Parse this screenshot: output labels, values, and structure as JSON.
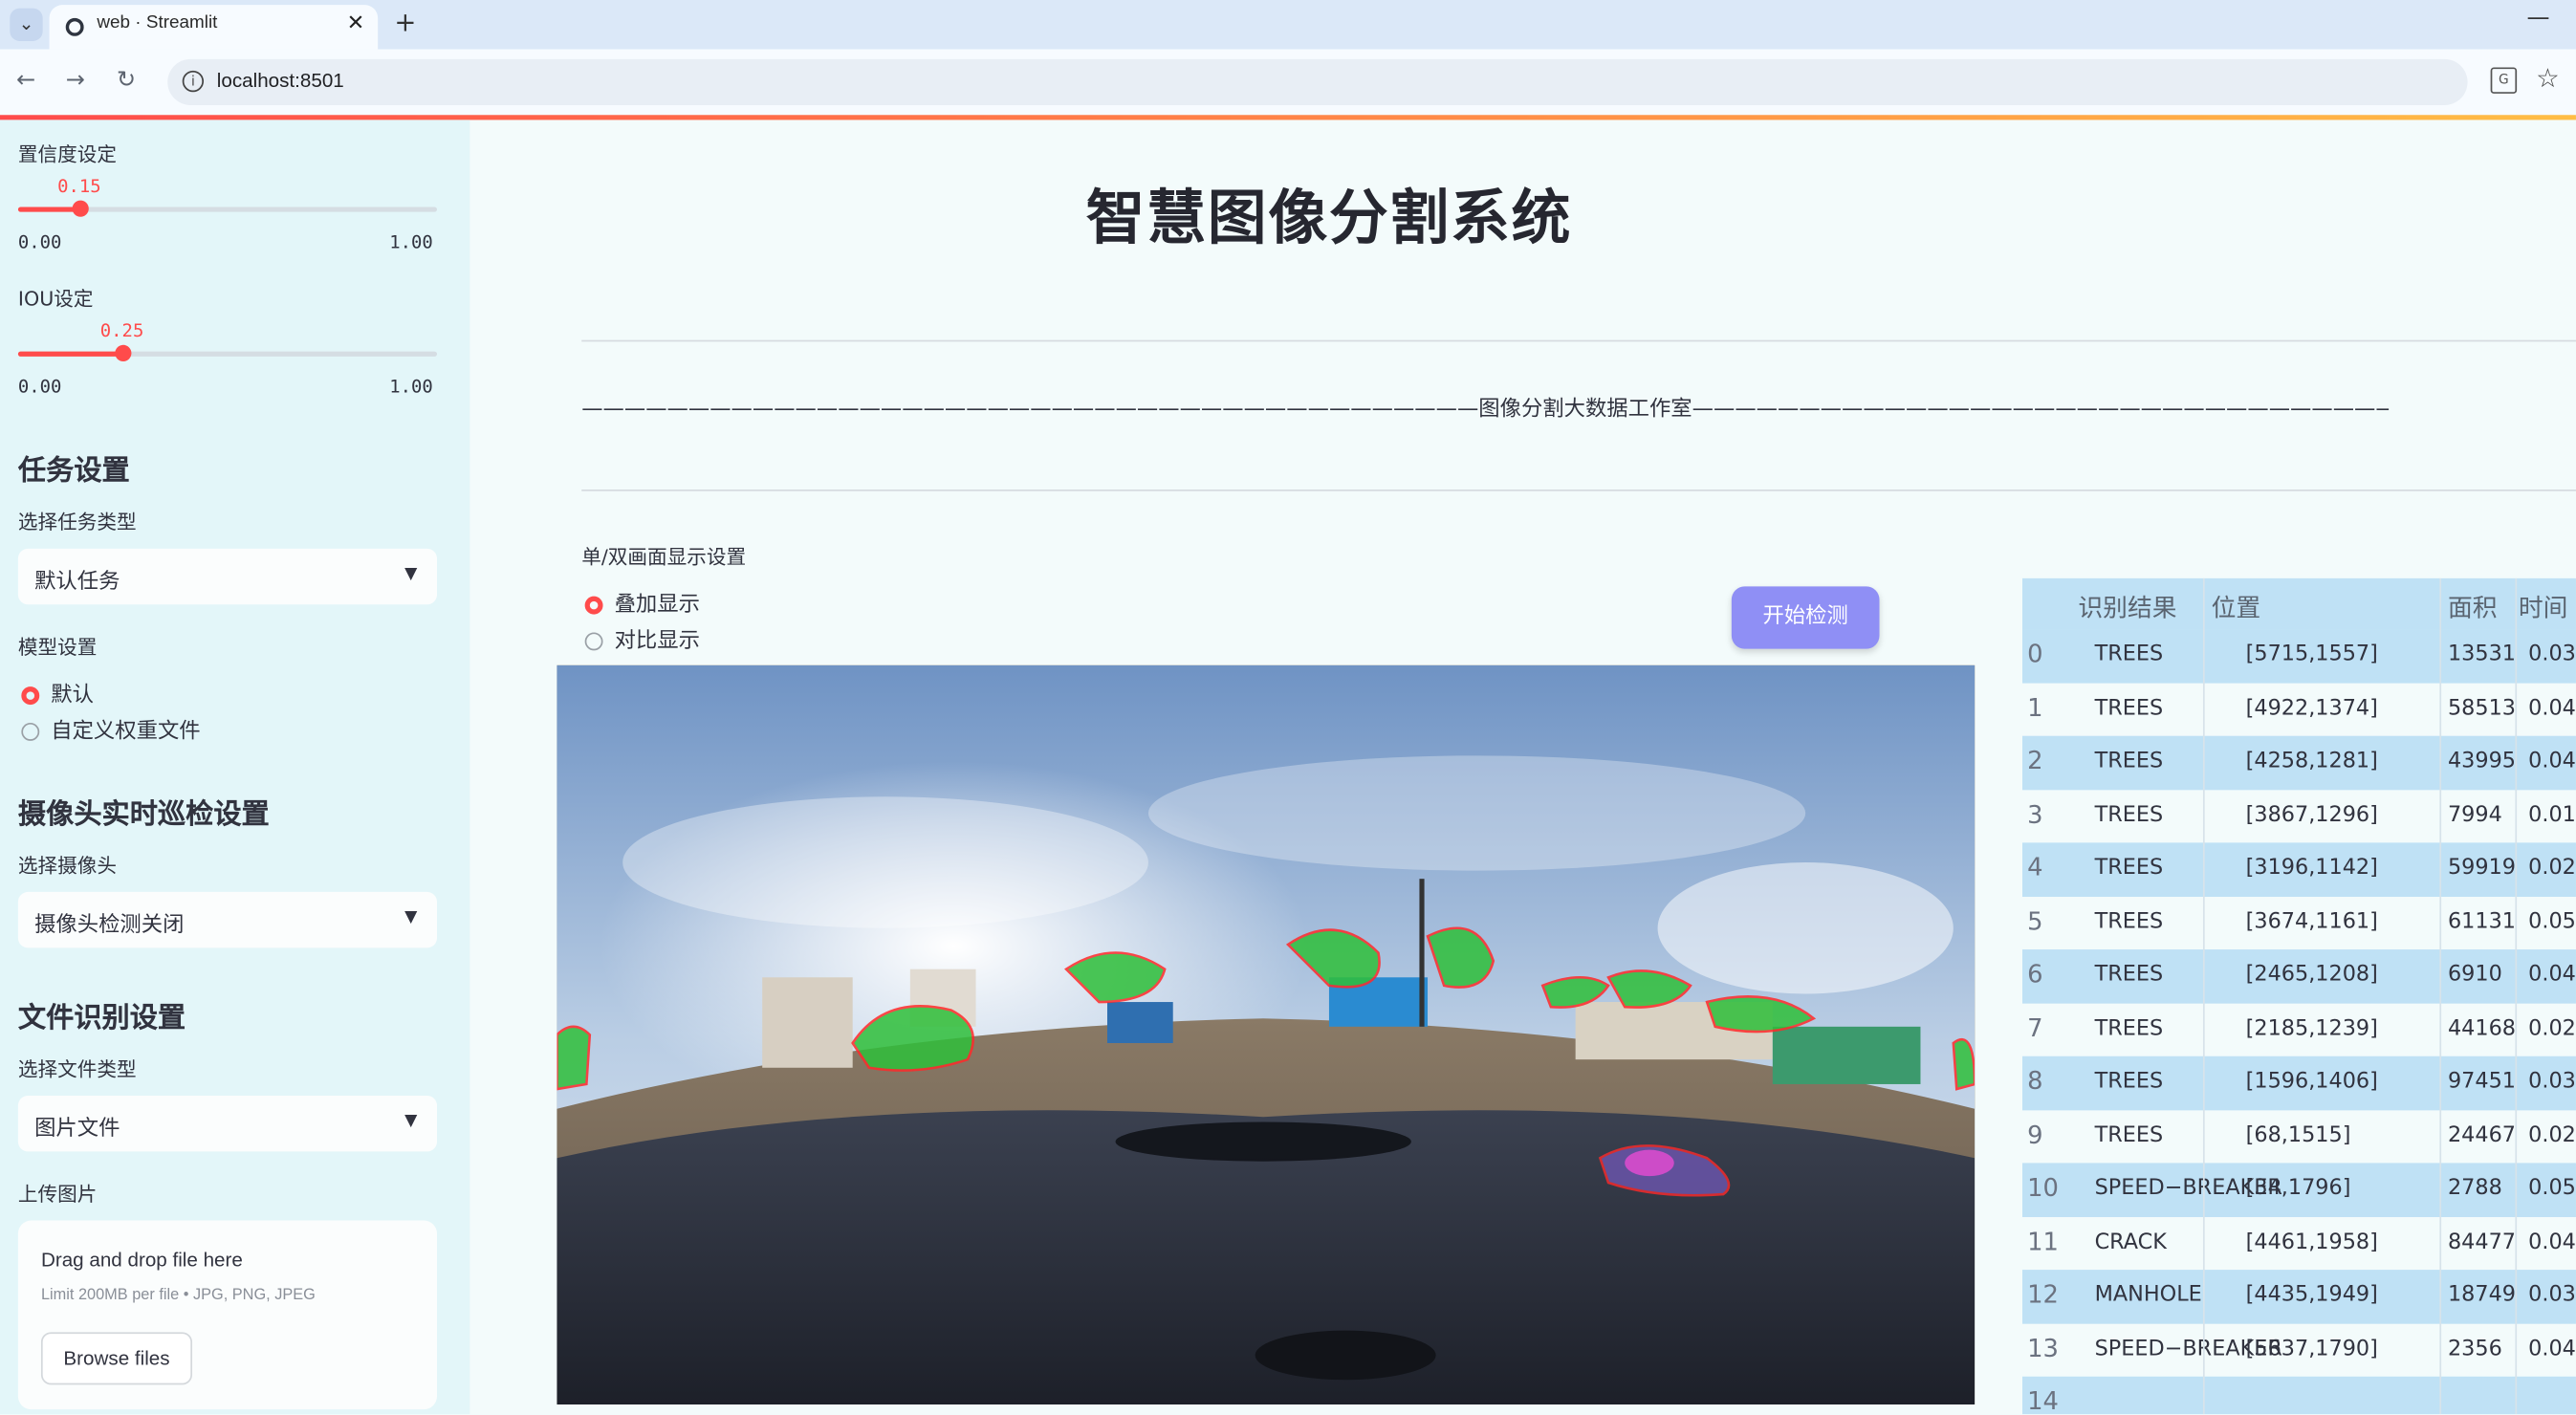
{
  "browser": {
    "tab_title": "web · Streamlit",
    "url": "localhost:8501",
    "new_tab_symbol": "+",
    "close_symbol": "✕",
    "minimize_symbol": "—"
  },
  "sidebar": {
    "confidence": {
      "label": "置信度设定",
      "value": "0.15",
      "value_num": 0.15,
      "min": "0.00",
      "max": "1.00"
    },
    "iou": {
      "label": "IOU设定",
      "value": "0.25",
      "value_num": 0.25,
      "min": "0.00",
      "max": "1.00"
    },
    "task_header": "任务设置",
    "task_type_label": "选择任务类型",
    "task_type_value": "默认任务",
    "model_label": "模型设置",
    "model_options": [
      "默认",
      "自定义权重文件"
    ],
    "model_selected": "默认",
    "camera_header": "摄像头实时巡检设置",
    "camera_label": "选择摄像头",
    "camera_value": "摄像头检测关闭",
    "file_header": "文件识别设置",
    "file_type_label": "选择文件类型",
    "file_type_value": "图片文件",
    "upload_label": "上传图片",
    "upload_title": "Drag and drop file here",
    "upload_limit": "Limit 200MB per file • JPG, PNG, JPEG",
    "browse_label": "Browse files"
  },
  "main": {
    "title": "智慧图像分割系统",
    "dash_text": "——————————————————————————————————————————图像分割大数据工作室——————————————————————————————————————————————————",
    "display_mode_label": "单/双画面显示设置",
    "display_options": [
      "叠加显示",
      "对比显示"
    ],
    "display_selected": "叠加显示",
    "start_button": "开始检测"
  },
  "results_table": {
    "columns": [
      "识别结果",
      "位置",
      "面积",
      "时间"
    ],
    "rows": [
      {
        "idx": "0",
        "label": "TREES",
        "pos": "[5715,1557]",
        "area": "13531",
        "time": "0.03"
      },
      {
        "idx": "1",
        "label": "TREES",
        "pos": "[4922,1374]",
        "area": "58513",
        "time": "0.04"
      },
      {
        "idx": "2",
        "label": "TREES",
        "pos": "[4258,1281]",
        "area": "43995",
        "time": "0.04"
      },
      {
        "idx": "3",
        "label": "TREES",
        "pos": "[3867,1296]",
        "area": "7994",
        "time": "0.01"
      },
      {
        "idx": "4",
        "label": "TREES",
        "pos": "[3196,1142]",
        "area": "59919",
        "time": "0.02"
      },
      {
        "idx": "5",
        "label": "TREES",
        "pos": "[3674,1161]",
        "area": "61131",
        "time": "0.05"
      },
      {
        "idx": "6",
        "label": "TREES",
        "pos": "[2465,1208]",
        "area": "6910",
        "time": "0.04"
      },
      {
        "idx": "7",
        "label": "TREES",
        "pos": "[2185,1239]",
        "area": "44168",
        "time": "0.02"
      },
      {
        "idx": "8",
        "label": "TREES",
        "pos": "[1596,1406]",
        "area": "97451",
        "time": "0.03"
      },
      {
        "idx": "9",
        "label": "TREES",
        "pos": "[68,1515]",
        "area": "24467",
        "time": "0.02"
      },
      {
        "idx": "10",
        "label": "SPEED−BREAKER",
        "pos": "[34,1796]",
        "area": "2788",
        "time": "0.05"
      },
      {
        "idx": "11",
        "label": "CRACK",
        "pos": "[4461,1958]",
        "area": "84477",
        "time": "0.04"
      },
      {
        "idx": "12",
        "label": "MANHOLE",
        "pos": "[4435,1949]",
        "area": "18749",
        "time": "0.03"
      },
      {
        "idx": "13",
        "label": "SPEED−BREAKER",
        "pos": "[5637,1790]",
        "area": "2356",
        "time": "0.04"
      },
      {
        "idx": "14",
        "label": "",
        "pos": "",
        "area": "",
        "time": ""
      }
    ]
  },
  "colors": {
    "accent": "#ff4b4b",
    "sidebar_bg": "#e3f6f9",
    "button_bg": "#8f8ff5",
    "table_stripe": "#bfe1f5"
  }
}
